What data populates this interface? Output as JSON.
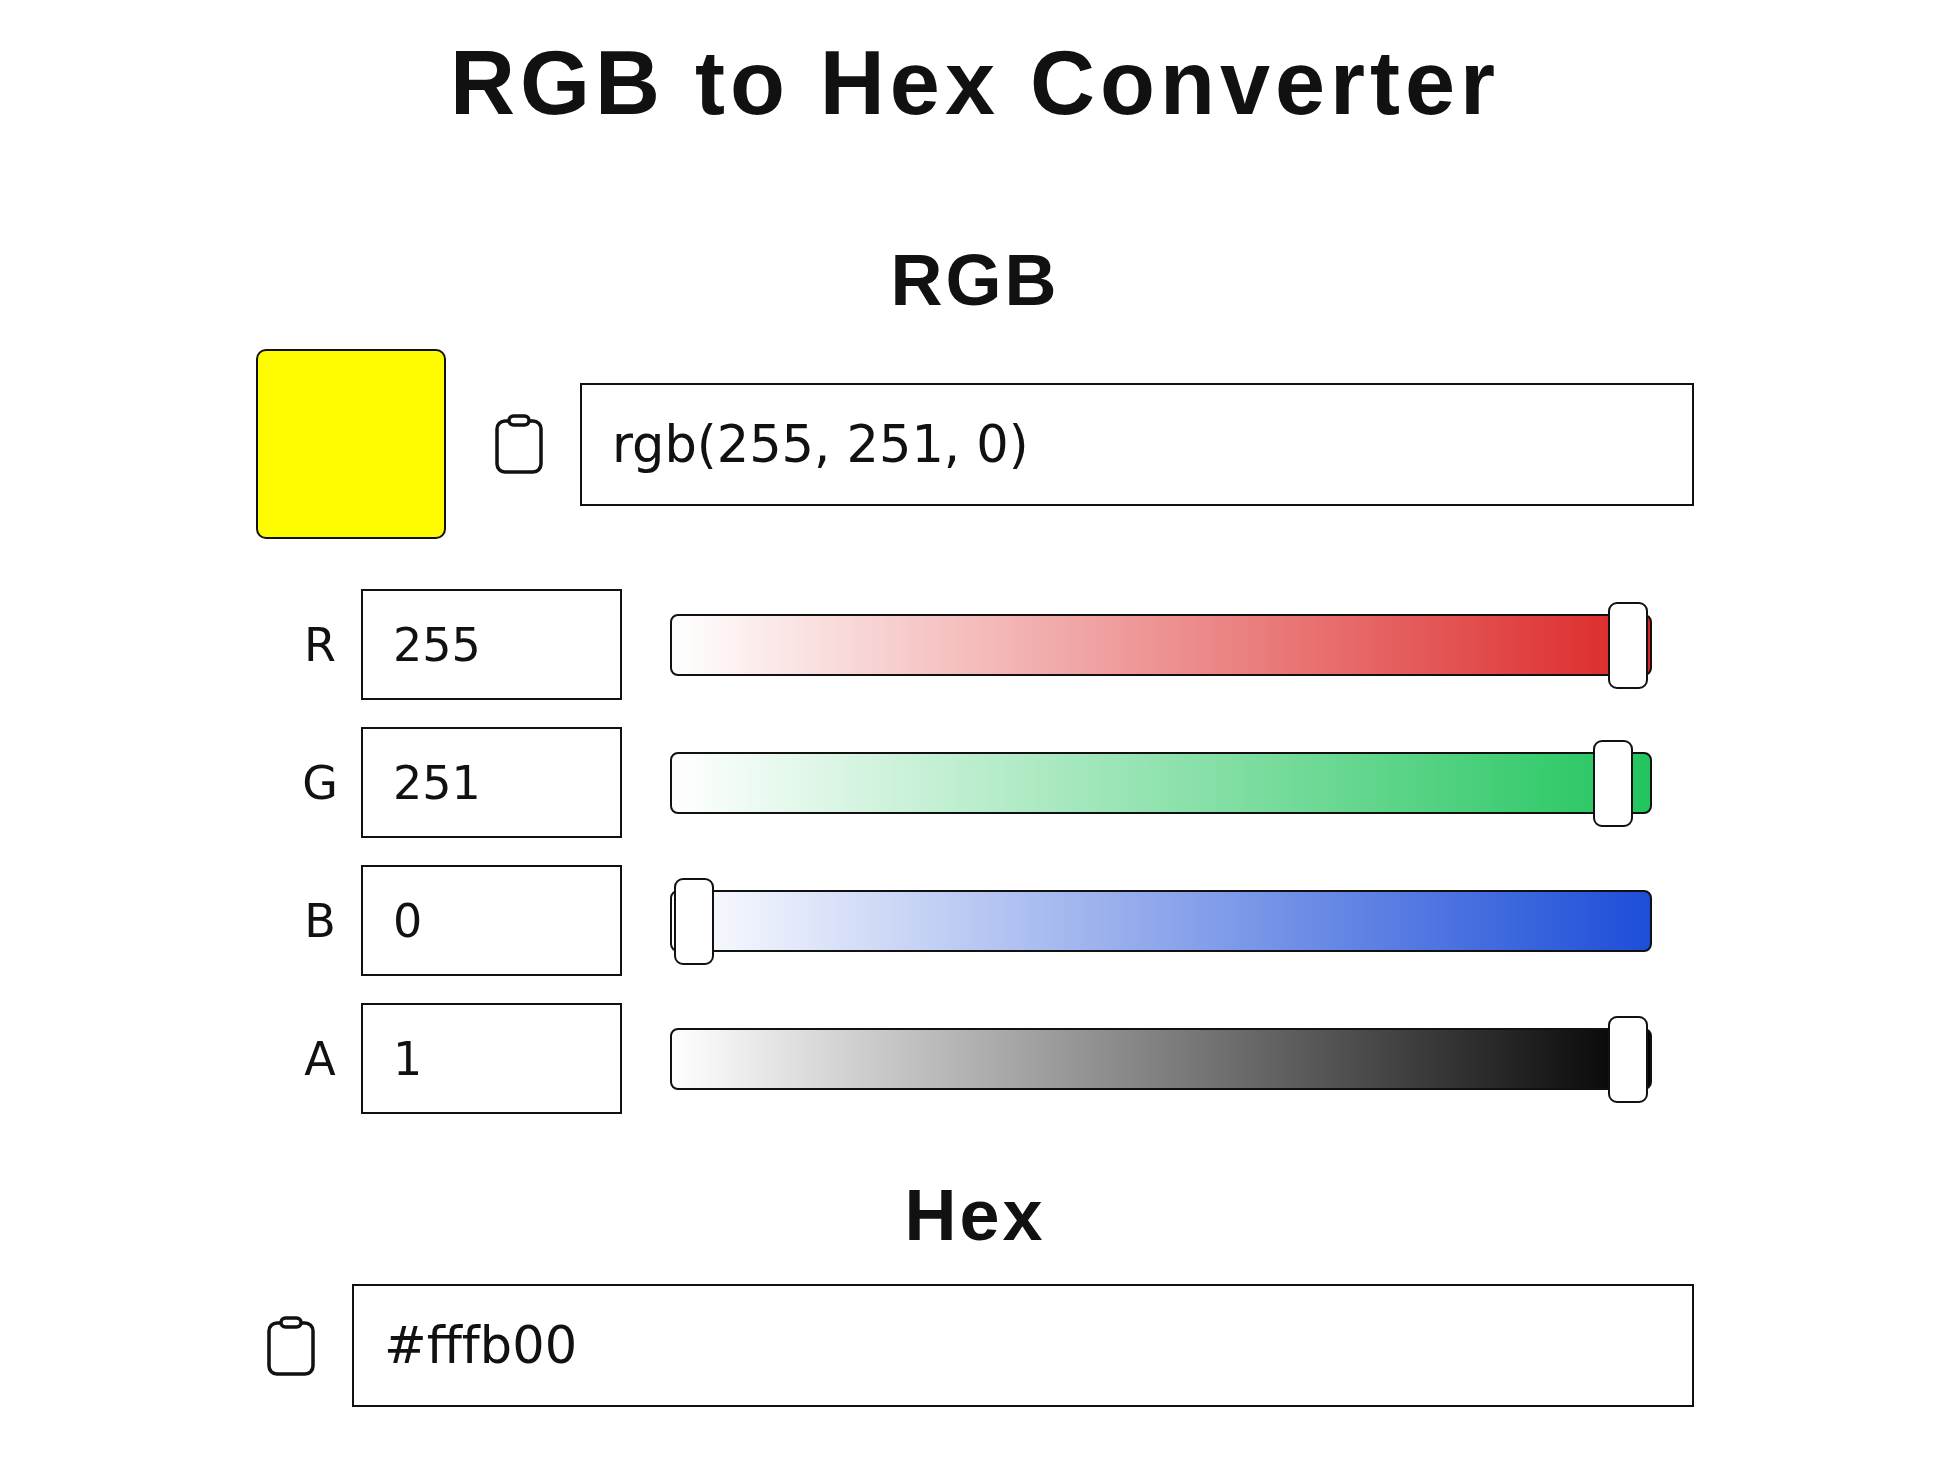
{
  "title": "RGB to Hex Converter",
  "rgb_section": {
    "heading": "RGB",
    "swatch": {
      "color": "#fffb00"
    },
    "value": "rgb(255, 251, 0)"
  },
  "channels": [
    {
      "label": "R",
      "value": "255",
      "level": 1,
      "color": "#dc2626"
    },
    {
      "label": "G",
      "value": "251",
      "level": 0.984,
      "color": "#22c55e"
    },
    {
      "label": "B",
      "value": "0",
      "level": 0,
      "color": "#1d4ed8"
    },
    {
      "label": "A",
      "value": "1",
      "level": 1,
      "color": "#000000"
    }
  ],
  "hex_section": {
    "heading": "Hex",
    "value": "#fffb00"
  }
}
